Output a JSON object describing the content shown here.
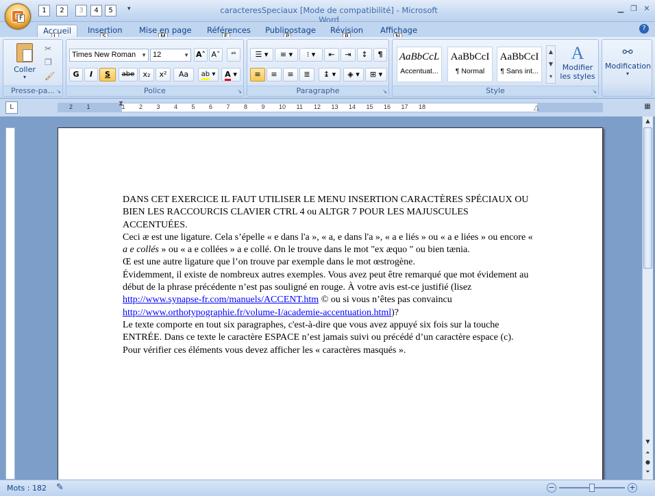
{
  "window": {
    "title": "caracteresSpeciaux [Mode de compatibilité] - Microsoft Word",
    "office_button_key": "F"
  },
  "quick_access": [
    "1",
    "2",
    "3",
    "4",
    "5"
  ],
  "tabs": [
    {
      "label": "Accueil",
      "key": "L",
      "active": true
    },
    {
      "label": "Insertion",
      "key": "S"
    },
    {
      "label": "Mise en page",
      "key": "M"
    },
    {
      "label": "Références",
      "key": "E"
    },
    {
      "label": "Publipostage",
      "key": "P"
    },
    {
      "label": "Révision",
      "key": "R"
    },
    {
      "label": "Affichage",
      "key": "N"
    }
  ],
  "ribbon": {
    "clipboard": {
      "label": "Presse-pa...",
      "paste": "Coller"
    },
    "font": {
      "label": "Police",
      "name": "Times New Roman",
      "size": "12",
      "bold": "G",
      "italic": "I",
      "underline": "S",
      "strike": "abe",
      "sub": "x₂",
      "sup": "x²",
      "case": "Aa"
    },
    "paragraph": {
      "label": "Paragraphe"
    },
    "styles": {
      "label": "Style",
      "items": [
        {
          "preview": "AaBbCcL",
          "name": "Accentuat..."
        },
        {
          "preview": "AaBbCcI",
          "name": "¶ Normal"
        },
        {
          "preview": "AaBbCcI",
          "name": "¶ Sans int..."
        }
      ],
      "modify": "Modifier les styles"
    },
    "editing": {
      "label": "Modification"
    }
  },
  "ruler_ticks": [
    "2",
    "1",
    "1",
    "2",
    "3",
    "4",
    "5",
    "6",
    "7",
    "8",
    "9",
    "10",
    "11",
    "12",
    "13",
    "14",
    "15",
    "16",
    "17",
    "18"
  ],
  "document": {
    "p1": "DANS CET EXERCICE IL FAUT UTILISER LE MENU INSERTION CARACTÈRES SPÉCIAUX OU BIEN LES RACCOURCIS CLAVIER CTRL 4 ou ALTGR 7 POUR LES MAJUSCULES ACCENTUÉES.",
    "p2a": "Ceci æ est une ligature.  Cela s’épelle « e dans l'a », « a, e dans l'a », « a e liés » ou « a e liées » ou encore « ",
    "p2b": "a e collés",
    "p2c": " » ou « a e collées » a e collé. On le trouve dans le mot \"ex æquo \" ou bien tænia.",
    "p3": "Œ est une autre ligature que l’on trouve par exemple dans le mot œstrogène.",
    "p4a": "Évidemment, il existe de nombreux autres exemples. Vous avez peut être remarqué que mot évidement au début de la phrase précédente n’est pas souligné en rouge. À votre avis est-ce justifié (lisez ",
    "p4link1": "http://www.synapse-fr.com/manuels/ACCENT.htm",
    "p4b": " © ou si vous n’êtes pas convaincu ",
    "p4link2": "http://www.orthotypographie.fr/volume-I/academie-accentuation.html",
    "p4c": ")?",
    "p5": "Le texte comporte en tout six paragraphes, c'est-à-dire que vous avez appuyé six fois sur la touche ENTRÉE. Dans ce texte le caractère ESPACE n’est jamais suivi ou précédé d’un caractère espace (c).",
    "p6": "Pour vérifier ces éléments vous devez afficher les « caractères masqués »."
  },
  "status": {
    "words": "Mots : 182"
  }
}
